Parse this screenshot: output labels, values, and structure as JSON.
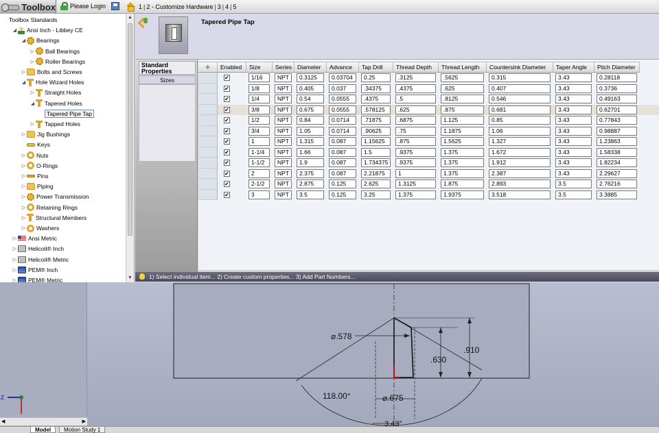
{
  "topbar": {
    "app_title": "Toolbox",
    "login_label": "Please Login",
    "breadcrumb": [
      {
        "label": "1"
      },
      {
        "label": "2 - Customize Hardware"
      },
      {
        "label": "3"
      },
      {
        "label": "4"
      },
      {
        "label": "5"
      }
    ]
  },
  "tree": {
    "nodes": [
      {
        "label": "Toolbox Standards",
        "depth": 0,
        "twisty": "",
        "icon": "none"
      },
      {
        "label": "Ansi Inch - Libbey CE",
        "depth": 1,
        "twisty": "◢",
        "icon": "user-icon"
      },
      {
        "label": "Bearings",
        "depth": 2,
        "twisty": "◢",
        "icon": "gear-icon"
      },
      {
        "label": "Ball Bearings",
        "depth": 3,
        "twisty": "▷",
        "icon": "gear-icon"
      },
      {
        "label": "Roller Bearings",
        "depth": 3,
        "twisty": "▷",
        "icon": "gear-icon"
      },
      {
        "label": "Bolts and Screws",
        "depth": 2,
        "twisty": "▷",
        "icon": "folder-icon"
      },
      {
        "label": "Hole Wizard Holes",
        "depth": 2,
        "twisty": "◢",
        "icon": "t-icon"
      },
      {
        "label": "Straight Holes",
        "depth": 3,
        "twisty": "▷",
        "icon": "t-icon"
      },
      {
        "label": "Tapered Holes",
        "depth": 3,
        "twisty": "◢",
        "icon": "t-icon"
      },
      {
        "label": "Tapered Pipe Tap",
        "depth": 4,
        "twisty": "",
        "icon": "none",
        "selected": true
      },
      {
        "label": "Tapped Holes",
        "depth": 3,
        "twisty": "▷",
        "icon": "t-icon"
      },
      {
        "label": "Jig Bushings",
        "depth": 2,
        "twisty": "▷",
        "icon": "folder-icon"
      },
      {
        "label": "Keys",
        "depth": 2,
        "twisty": "",
        "icon": "key-icon"
      },
      {
        "label": "Nuts",
        "depth": 2,
        "twisty": "▷",
        "icon": "ring-icon"
      },
      {
        "label": "O-Rings",
        "depth": 2,
        "twisty": "▷",
        "icon": "ring-icon"
      },
      {
        "label": "Pins",
        "depth": 2,
        "twisty": "▷",
        "icon": "pin-icon"
      },
      {
        "label": "Piping",
        "depth": 2,
        "twisty": "▷",
        "icon": "folder-icon"
      },
      {
        "label": "Power Transmission",
        "depth": 2,
        "twisty": "▷",
        "icon": "gear-icon"
      },
      {
        "label": "Retaining Rings",
        "depth": 2,
        "twisty": "▷",
        "icon": "ring-icon"
      },
      {
        "label": "Structural Members",
        "depth": 2,
        "twisty": "▷",
        "icon": "t-icon"
      },
      {
        "label": "Washers",
        "depth": 2,
        "twisty": "▷",
        "icon": "ring-icon"
      },
      {
        "label": "Ansi Metric",
        "depth": 1,
        "twisty": "▷",
        "icon": "flag-icon"
      },
      {
        "label": "Helicoil® Inch",
        "depth": 1,
        "twisty": "▷",
        "icon": "coil-icon"
      },
      {
        "label": "Helicoil® Metric",
        "depth": 1,
        "twisty": "▷",
        "icon": "coil-icon"
      },
      {
        "label": "PEM® Inch",
        "depth": 1,
        "twisty": "▷",
        "icon": "pem-icon"
      },
      {
        "label": "PEM® Metric",
        "depth": 1,
        "twisty": "▷",
        "icon": "pem-icon"
      }
    ]
  },
  "header": {
    "part_title": "Tapered Pipe Tap"
  },
  "props": {
    "header": "Standard Properties",
    "sizes_label": "Sizes"
  },
  "grid": {
    "columns": [
      "",
      "Enabled",
      "Size",
      "Series",
      "Diameter",
      "Advance",
      "Tap Drill",
      "Thread Depth",
      "Thread Length",
      "Countersink Diameter",
      "Taper Angle",
      "Pitch Diameter"
    ],
    "rows": [
      {
        "enabled": "✔",
        "size": "1/16",
        "series": "NPT",
        "diameter": "0.3125",
        "advance": "0.03704",
        "tap_drill": "0.25",
        "thread_depth": ".3125",
        "thread_length": ".5625",
        "countersink": "0.315",
        "taper": "3.43",
        "pitch": "0.28118"
      },
      {
        "enabled": "✔",
        "size": "1/8",
        "series": "NPT",
        "diameter": "0.405",
        "advance": "0.037",
        "tap_drill": ".34375",
        "thread_depth": ".4375",
        "thread_length": ".625",
        "countersink": "0.407",
        "taper": "3.43",
        "pitch": "0.3736"
      },
      {
        "enabled": "✔",
        "size": "1/4",
        "series": "NPT",
        "diameter": "0.54",
        "advance": "0.0555",
        "tap_drill": ".4375",
        "thread_depth": ".5",
        "thread_length": ".8125",
        "countersink": "0.546",
        "taper": "3.43",
        "pitch": "0.49163"
      },
      {
        "enabled": "✔",
        "size": "3/8",
        "series": "NPT",
        "diameter": "0.675",
        "advance": "0.0555",
        "tap_drill": ".578125",
        "thread_depth": ".625",
        "thread_length": ".875",
        "countersink": "0.681",
        "taper": "3.43",
        "pitch": "0.62701",
        "highlight": true
      },
      {
        "enabled": "✔",
        "size": "1/2",
        "series": "NPT",
        "diameter": "0.84",
        "advance": "0.0714",
        "tap_drill": ".71875",
        "thread_depth": ".6875",
        "thread_length": "1.125",
        "countersink": "0.85",
        "taper": "3.43",
        "pitch": "0.77843"
      },
      {
        "enabled": "✔",
        "size": "3/4",
        "series": "NPT",
        "diameter": "1.05",
        "advance": "0.0714",
        "tap_drill": ".90625",
        "thread_depth": ".75",
        "thread_length": "1.1875",
        "countersink": "1.06",
        "taper": "3.43",
        "pitch": "0.98887"
      },
      {
        "enabled": "✔",
        "size": "1",
        "series": "NPT",
        "diameter": "1.315",
        "advance": "0.087",
        "tap_drill": "1.15625",
        "thread_depth": ".875",
        "thread_length": "1.5625",
        "countersink": "1.327",
        "taper": "3.43",
        "pitch": "1.23863"
      },
      {
        "enabled": "✔",
        "size": "1-1/4",
        "series": "NPT",
        "diameter": "1.66",
        "advance": "0.087",
        "tap_drill": "1.5",
        "thread_depth": ".9375",
        "thread_length": "1.375",
        "countersink": "1.672",
        "taper": "3.43",
        "pitch": "1.58338"
      },
      {
        "enabled": "✔",
        "size": "1-1/2",
        "series": "NPT",
        "diameter": "1.9",
        "advance": "0.087",
        "tap_drill": "1.734375",
        "thread_depth": ".9375",
        "thread_length": "1.375",
        "countersink": "1.912",
        "taper": "3.43",
        "pitch": "1.82234"
      },
      {
        "enabled": "✔",
        "size": "2",
        "series": "NPT",
        "diameter": "2.375",
        "advance": "0.087",
        "tap_drill": "2.21875",
        "thread_depth": "1",
        "thread_length": "1.375",
        "countersink": "2.387",
        "taper": "3.43",
        "pitch": "2.29627"
      },
      {
        "enabled": "✔",
        "size": "2-1/2",
        "series": "NPT",
        "diameter": "2.875",
        "advance": "0.125",
        "tap_drill": "2.625",
        "thread_depth": "1.3125",
        "thread_length": "1.875",
        "countersink": "2.893",
        "taper": "3.5",
        "pitch": "2.76216"
      },
      {
        "enabled": "✔",
        "size": "3",
        "series": "NPT",
        "diameter": "3.5",
        "advance": "0.125",
        "tap_drill": "3.25",
        "thread_depth": "1.375",
        "thread_length": "1.9375",
        "countersink": "3.518",
        "taper": "3.5",
        "pitch": "3.3885"
      }
    ]
  },
  "status": {
    "text": "1) Select individual item... 2) Create custom properties... 3) Add Part Numbers..."
  },
  "drawing": {
    "dim_tap_drill": "⌀.578",
    "dim_diameter": "⌀.675",
    "dim_thread_depth": ".630",
    "dim_thread_length": ".910",
    "dim_angle": "118.00°",
    "dim_taper": "3.43°",
    "axis_z": "Z"
  },
  "bottom_tabs": {
    "model": "Model",
    "motion": "Motion Study 1"
  }
}
